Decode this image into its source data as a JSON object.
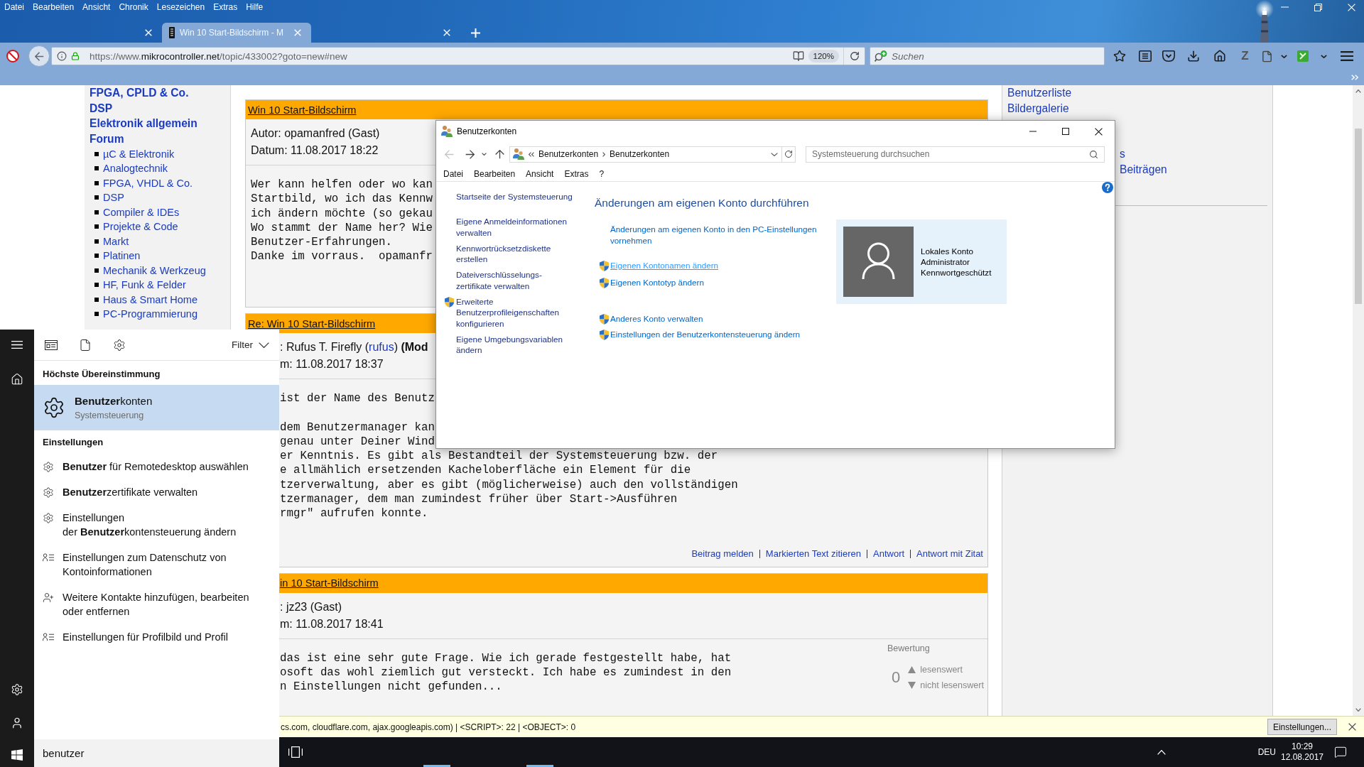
{
  "browser": {
    "menu": [
      "Datei",
      "Bearbeiten",
      "Ansicht",
      "Chronik",
      "Lesezeichen",
      "Extras",
      "Hilfe"
    ],
    "tabs": [
      {
        "selected": false
      },
      {
        "title": "Win 10 Start-Bildschirm - M",
        "selected": true
      },
      {
        "selected": false
      }
    ],
    "address": {
      "scheme": "https://www.",
      "domain": "mikrocontroller.net",
      "path": "/topic/433002?goto=new#new",
      "zoom": "120%"
    },
    "search": {
      "placeholder": "Suchen"
    },
    "addon_label": "Z"
  },
  "forum": {
    "sections": [
      "FPGA, CPLD & Co.",
      "DSP",
      "Elektronik allgemein",
      "Forum"
    ],
    "forums": [
      "µC & Elektronik",
      "Analogtechnik",
      "FPGA, VHDL & Co.",
      "DSP",
      "Compiler & IDEs",
      "Projekte & Code",
      "Markt",
      "Platinen",
      "Mechanik & Werkzeug",
      "HF, Funk & Felder",
      "Haus & Smart Home",
      "PC-Programmierung"
    ],
    "posts": [
      {
        "title": "Win 10 Start-Bildschirm",
        "author": [
          {
            "kind": "text",
            "text": "Autor: opamanfred (Gast)"
          }
        ],
        "date": "Datum: 11.08.2017 18:22",
        "body": [
          [
            "Wer kann helfen oder wo kan",
            "Startbild, wo ich das Kennw",
            "ich ändern möchte (so gekau",
            "Wo stammt der Name her? Wie",
            "Benutzer-Erfahrungen.",
            "Danke im vorraus.  opamanfr"
          ]
        ]
      },
      {
        "title": "Re: Win 10 Start-Bildschirm",
        "author": [
          {
            "kind": "text",
            "text": ": Rufus T. Firefly ("
          },
          {
            "kind": "link",
            "text": "rufus"
          },
          {
            "kind": "text",
            "text": ") "
          },
          {
            "kind": "strong",
            "text": "(Mod"
          }
        ],
        "date": "m: 11.08.2017 18:37",
        "body": [
          [
            "ist der Name des Benutz"
          ],
          [
            "dem Benutzermanager kan",
            "genau unter Deiner Wind",
            "er Kenntnis. Es gibt als Bestandteil der Systemsteuerung bzw. der",
            "e allmählich ersetzenden Kacheloberfläche ein Element für die",
            "tzerverwaltung, aber es gibt (möglicherweise) auch den vollständigen",
            "tzermanager, dem man zumindest früher über Start->Ausführen",
            "rmgr\" aufrufen konnte."
          ]
        ],
        "actions": [
          "Beitrag melden",
          "Markierten Text zitieren",
          "Antwort",
          "Antwort mit Zitat"
        ]
      },
      {
        "title": "in 10 Start-Bildschirm",
        "author": [
          {
            "kind": "text",
            "text": ": jz23 (Gast)"
          }
        ],
        "date": "m: 11.08.2017 18:41",
        "body": [
          [
            "das ist eine sehr gute Frage. Wie ich gerade festgestellt habe, hat",
            "osoft das wohl ziemlich gut versteckt. Ich habe es zumindest in den",
            "n Einstellungen nicht gefunden..."
          ]
        ],
        "rating": {
          "label": "Bewertung",
          "score": "0",
          "up": "lesenswert",
          "down": "nicht lesenswert"
        }
      }
    ],
    "side_links": [
      "Benutzerliste",
      "Bildergalerie"
    ],
    "side_fragments": [
      "s",
      "Beiträgen"
    ]
  },
  "dialog": {
    "title": "Benutzerkonten",
    "back_disabled": true,
    "breadcrumb": [
      "Benutzerkonten",
      "Benutzerkonten"
    ],
    "search": {
      "placeholder": "Systemsteuerung durchsuchen"
    },
    "menu": [
      "Datei",
      "Bearbeiten",
      "Ansicht",
      "Extras",
      "?"
    ],
    "nav_groups": [
      [
        {
          "label": "Startseite der Systemsteuerung",
          "shield": false
        }
      ],
      [
        {
          "label": "Eigene Anmeldeinformationen verwalten",
          "shield": false
        },
        {
          "label": "Kennwortrücksetzdiskette erstellen",
          "shield": false
        },
        {
          "label": "Dateiverschlüsselungs-zertifikate verwalten",
          "shield": false
        },
        {
          "label": "Erweiterte Benutzerprofileigenschaften konfigurieren",
          "shield": true
        },
        {
          "label": "Eigene Umgebungsvariablen ändern",
          "shield": false
        }
      ]
    ],
    "heading": "Änderungen am eigenen Konto durchführen",
    "task_groups": [
      [
        {
          "label": "Änderungen am eigenen Konto in den PC-Einstellungen vornehmen",
          "shield": false,
          "hovered": false
        }
      ],
      [
        {
          "label": "Eigenen Kontonamen ändern",
          "shield": true,
          "hovered": true
        },
        {
          "label": "Eigenen Kontotyp ändern",
          "shield": true,
          "hovered": false
        }
      ],
      [
        {
          "label": "Anderes Konto verwalten",
          "shield": true,
          "hovered": false
        },
        {
          "label": "Einstellungen der Benutzerkontensteuerung ändern",
          "shield": true,
          "hovered": false
        }
      ]
    ],
    "account": [
      "Lokales Konto",
      "Administrator",
      "Kennwortgeschützt"
    ]
  },
  "start_menu": {
    "filter": "Filter",
    "best_match_heading": "Höchste Übereinstimmung",
    "best_match": {
      "title": "**Benutzer**konten",
      "subtitle": "Systemsteuerung",
      "selected": true
    },
    "settings_heading": "Einstellungen",
    "results": [
      {
        "kind": "gear",
        "text": "**Benutzer** für Remotedesktop auswählen"
      },
      {
        "kind": "gear",
        "text": "**Benutzer**zertifikate verwalten"
      },
      {
        "kind": "gear",
        "text": "Einstellungen\nder **Benutzer**kontensteuerung ändern"
      },
      {
        "kind": "contact",
        "text": "Einstellungen zum Datenschutz von Kontoinformationen"
      },
      {
        "kind": "addcontact",
        "text": "Weitere Kontakte hinzufügen, bearbeiten oder entfernen"
      },
      {
        "kind": "contact",
        "text": "Einstellungen für Profilbild und Profil"
      }
    ],
    "query": "benutzer"
  },
  "notification": {
    "text": "cs.com, cloudflare.com, ajax.googleapis.com) | <SCRIPT>: 22 | <OBJECT>: 0",
    "button": "Einstellungen..."
  },
  "taskbar": {
    "apps": [
      {
        "running": true
      },
      {
        "running": true
      }
    ],
    "language": "DEU",
    "time": "10:29",
    "date": "12.08.2017"
  }
}
